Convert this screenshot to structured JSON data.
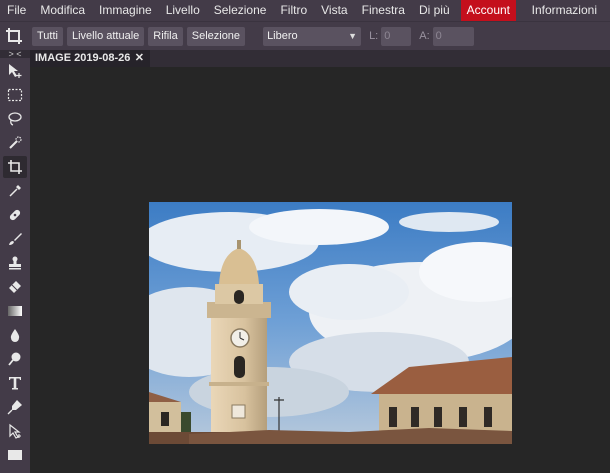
{
  "menu": {
    "items": [
      "File",
      "Modifica",
      "Immagine",
      "Livello",
      "Selezione",
      "Filtro",
      "Vista",
      "Finestra",
      "Di più"
    ],
    "account": "Account",
    "right": "Informazioni"
  },
  "options": {
    "buttons": [
      "Tutti",
      "Livello attuale",
      "Rifila",
      "Selezione"
    ],
    "ratio_select": "Libero",
    "width_label": "L:",
    "width_value": "0",
    "height_label": "A:",
    "height_value": "0"
  },
  "tabs": {
    "collapse": "> <\n> <",
    "document": "IMAGE 2019-08-26",
    "close": "✕"
  },
  "tools": [
    "move-icon",
    "rect-select-icon",
    "lasso-icon",
    "quick-select-icon",
    "crop-icon",
    "eyedropper-icon",
    "healing-icon",
    "brush-icon",
    "stamp-icon",
    "eraser-icon",
    "gradient-icon",
    "blur-icon",
    "dodge-icon",
    "text-icon",
    "pen-icon",
    "direct-select-icon",
    "shape-icon"
  ],
  "colors": {
    "chrome": "#433b48",
    "accent": "#c40f1c",
    "workspace": "#262626"
  }
}
